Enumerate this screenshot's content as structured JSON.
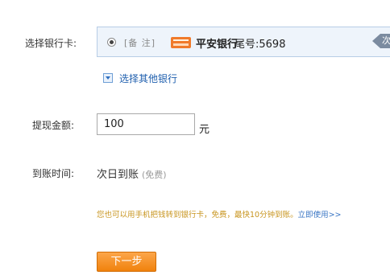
{
  "form": {
    "bank_card_label": "选择银行卡:",
    "amount_label": "提现金额:",
    "arrival_label": "到账时间:"
  },
  "card": {
    "remark": "[备 注]",
    "bank_name": "平安银行",
    "tail_label": "尾号:",
    "tail_number": "5698",
    "next_tag": "次",
    "selected": true
  },
  "other_bank": {
    "label": "选择其他银行"
  },
  "amount": {
    "value": "100",
    "unit": "元"
  },
  "arrival": {
    "value": "次日到账",
    "note": "(免费)"
  },
  "tip": {
    "text": "您也可以用手机把钱转到银行卡，免费，最快10分钟到账。",
    "link": "立即使用>>"
  },
  "buttons": {
    "next": "下一步"
  }
}
